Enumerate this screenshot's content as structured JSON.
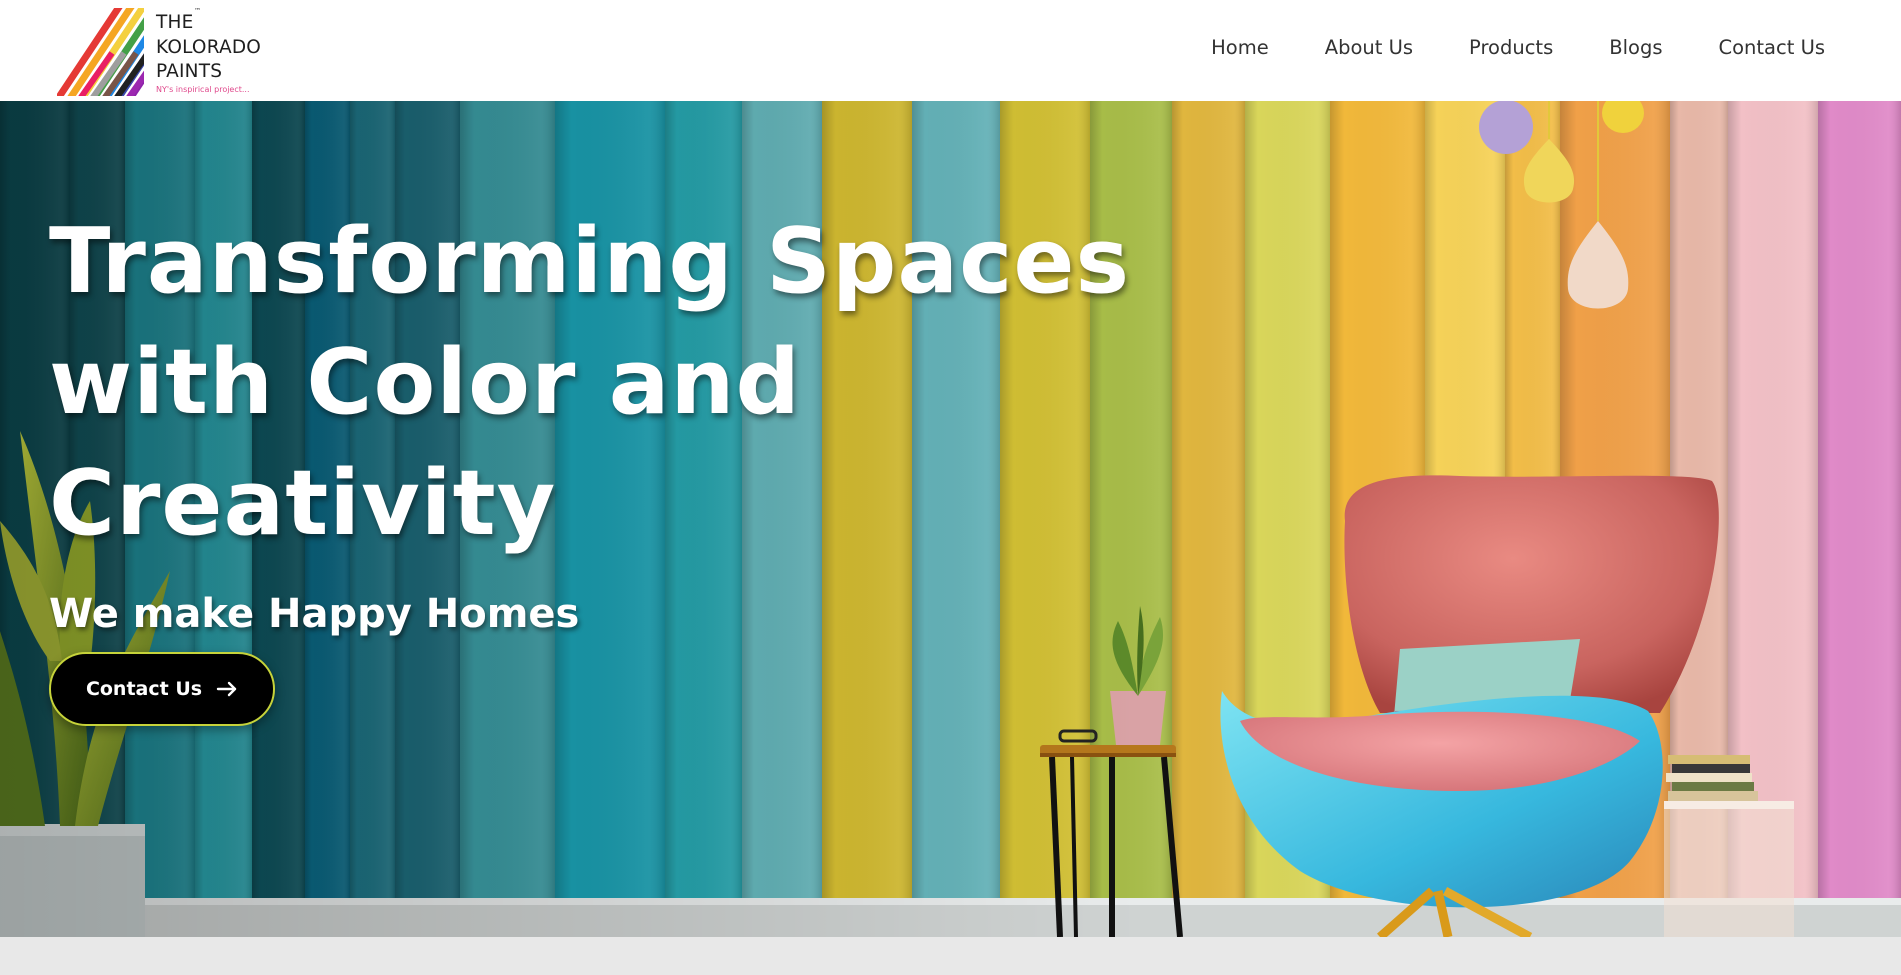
{
  "brand": {
    "line1": "THE",
    "line2": "KOLORADO",
    "line3": "PAINTS",
    "trademark": "™",
    "tagline": "NY's inspirical project...",
    "stripe_colors": [
      "#e53935",
      "#f5a623",
      "#f4d03f",
      "#43a047",
      "#1e88e5",
      "#3949ab",
      "#8e24aa"
    ],
    "bottom_stripe_colors": [
      "#e91e63",
      "#9e9e9e",
      "#795548",
      "#212121",
      "#9c27b0"
    ]
  },
  "nav": {
    "items": [
      "Home",
      "About Us",
      "Products",
      "Blogs",
      "Contact Us"
    ]
  },
  "hero": {
    "title": "Transforming Spaces with Color and Creativity",
    "subtitle": "We make Happy Homes",
    "cta_label": "Contact Us",
    "cta_icon": "arrow-right-icon",
    "background_description_colors": [
      "#0d4a52",
      "#18a0ac",
      "#2d8fa6",
      "#d8c03a",
      "#a8bd48",
      "#f0b840",
      "#ee9840",
      "#f2bcc4",
      "#e07ac6"
    ]
  }
}
